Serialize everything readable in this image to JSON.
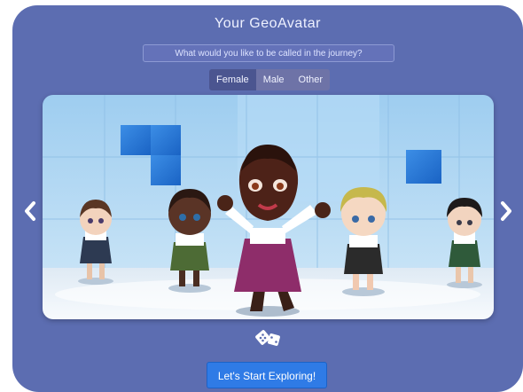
{
  "app": {
    "title": "Your GeoAvatar"
  },
  "name_field": {
    "placeholder": "What would you like to be called in the journey?",
    "value": ""
  },
  "gender_options": [
    {
      "label": "Female",
      "selected": true
    },
    {
      "label": "Male",
      "selected": false
    },
    {
      "label": "Other",
      "selected": false
    }
  ],
  "carousel": {
    "prev_icon": "chevron-left-icon",
    "next_icon": "chevron-right-icon",
    "avatar_count": 5,
    "selected_avatar": 3
  },
  "randomize": {
    "icon": "dice-icon"
  },
  "start_button": {
    "label": "Let's Start Exploring!"
  },
  "colors": {
    "panel": "#5c6db1",
    "accent": "#2f7be6",
    "selected_toggle": "#4b5590"
  }
}
